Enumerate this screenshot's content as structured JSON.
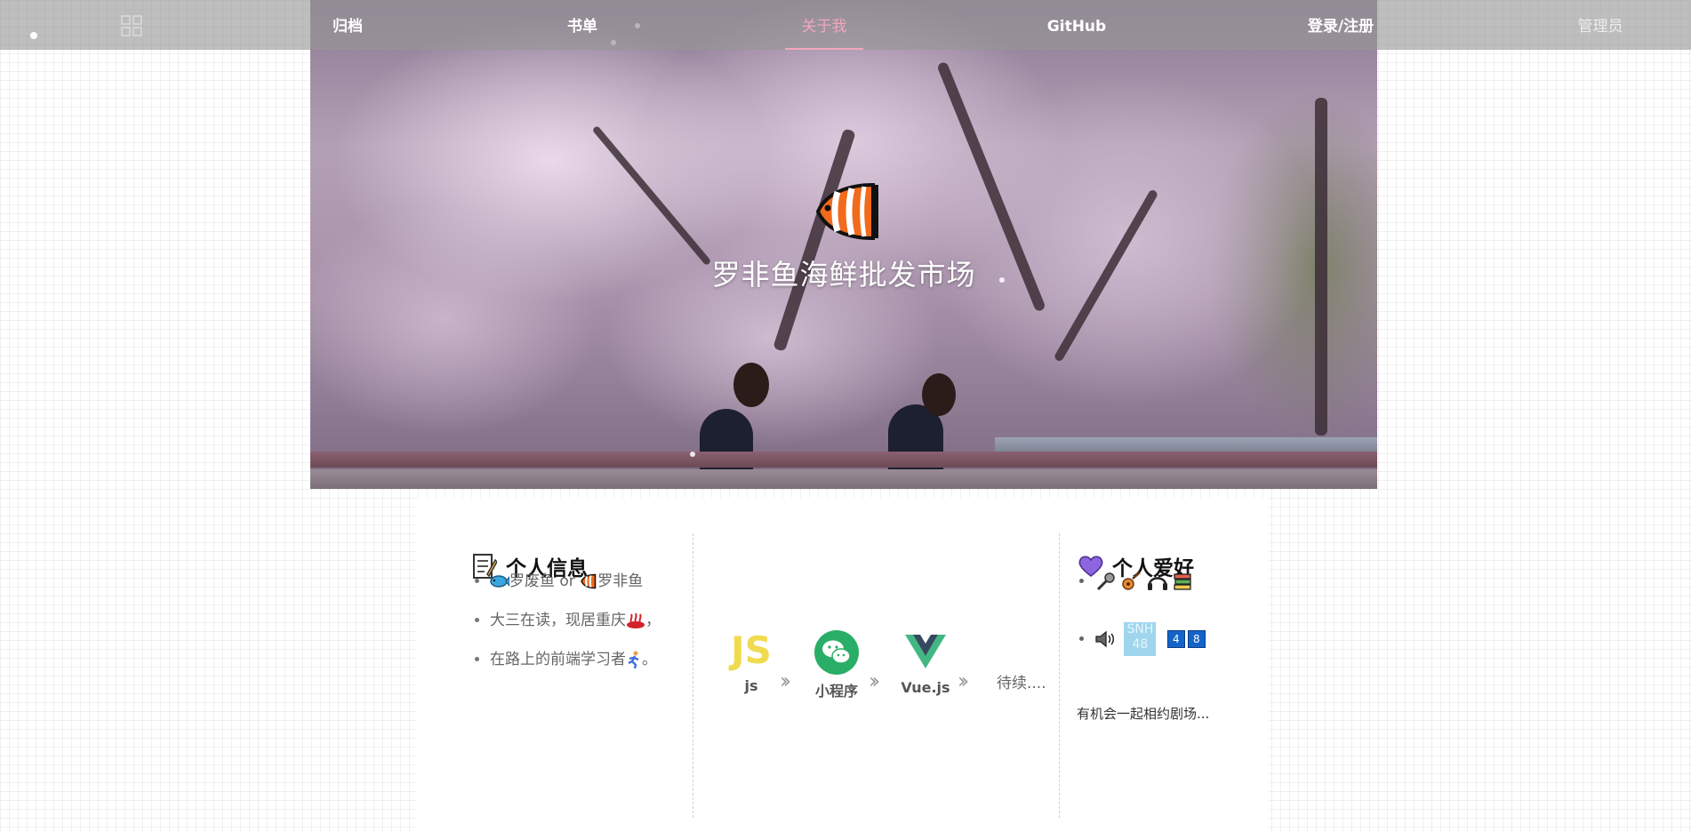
{
  "nav": {
    "items": [
      {
        "label": "归档"
      },
      {
        "label": "书单"
      },
      {
        "label": "关于我"
      },
      {
        "label": "GitHub"
      },
      {
        "label": "登录/注册"
      },
      {
        "label": "管理员"
      }
    ],
    "active_index": 2,
    "icons": [
      "grid-icon"
    ]
  },
  "hero": {
    "title": "罗非鱼海鲜批发市场",
    "logo_icon": "clownfish-icon"
  },
  "personal_info": {
    "title": "个人信息",
    "title_icon": "memo-icon",
    "items": [
      {
        "prefix_icon": "fish-icon",
        "name1": "罗废鱼",
        "sep": " or ",
        "icon2": "clownfish-icon",
        "name2": "罗非鱼"
      },
      {
        "text": "大三在读，现居重庆",
        "icon": "hotspring-icon",
        "suffix": "，"
      },
      {
        "text": "在路上的前端学习者",
        "icon": "runner-icon",
        "suffix": "。"
      }
    ]
  },
  "tech_stack": {
    "items": [
      {
        "label": "js",
        "icon": "javascript-icon",
        "logo_text": "JS"
      },
      {
        "label": "小程序",
        "icon": "wechat-icon"
      },
      {
        "label": "Vue.js",
        "icon": "vue-icon"
      }
    ],
    "pending": "待续...."
  },
  "hobbies": {
    "title": "个人爱好",
    "title_icon": "purple-heart-icon",
    "row1_icons": [
      "microphone-icon",
      "guitar-icon",
      "headphones-icon",
      "books-icon"
    ],
    "row2": {
      "speaker_icon": "speaker-icon",
      "logo_text_1": "SNH",
      "logo_text_2": "48",
      "badge1": "4",
      "badge2": "8"
    },
    "note": "有机会一起相约剧场..."
  },
  "colors": {
    "nav_bg": "#969696",
    "nav_active": "#f2a7bd",
    "js_yellow": "#f0db4f",
    "wechat_green": "#2aae67",
    "vue_green": "#41b883",
    "vue_dark": "#35495e"
  }
}
